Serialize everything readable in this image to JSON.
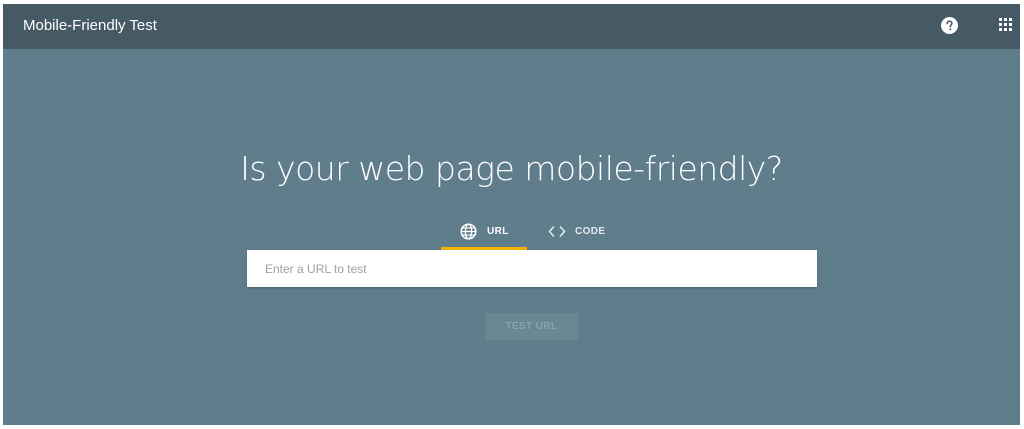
{
  "app": {
    "title": "Mobile-Friendly Test"
  },
  "header": {
    "help_icon": "help-circle-icon",
    "apps_icon": "apps-grid-icon"
  },
  "main": {
    "headline": "Is your web page mobile-friendly?",
    "tabs": [
      {
        "label": "URL",
        "icon": "globe-icon",
        "selected": true
      },
      {
        "label": "CODE",
        "icon": "code-icon",
        "selected": false
      }
    ],
    "url_input": {
      "value": "",
      "placeholder": "Enter a URL to test"
    },
    "submit_label": "TEST URL",
    "submit_enabled": false
  },
  "colors": {
    "background": "#607d8b",
    "topbar": "#455a64",
    "tab_indicator": "#f4b400",
    "input_background": "#ffffff"
  }
}
